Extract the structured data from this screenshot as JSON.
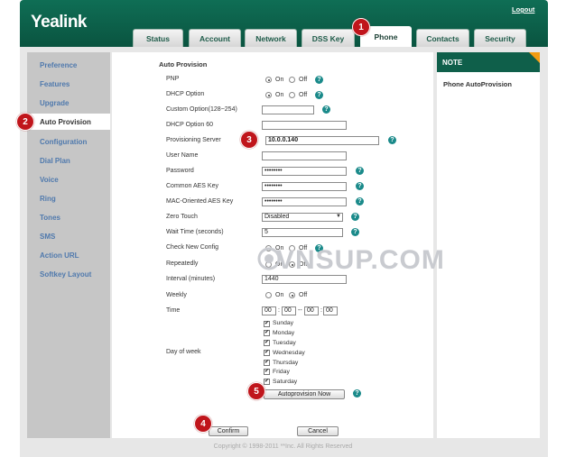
{
  "header": {
    "logo": "Yealink",
    "logout": "Logout"
  },
  "tabs": [
    {
      "label": "Status",
      "active": false
    },
    {
      "label": "Account",
      "active": false
    },
    {
      "label": "Network",
      "active": false
    },
    {
      "label": "DSS Key",
      "active": false
    },
    {
      "label": "Phone",
      "active": true
    },
    {
      "label": "Contacts",
      "active": false
    },
    {
      "label": "Security",
      "active": false
    }
  ],
  "sidebar": {
    "items": [
      "Preference",
      "Features",
      "Upgrade",
      "Auto Provision",
      "Configuration",
      "Dial Plan",
      "Voice",
      "Ring",
      "Tones",
      "SMS",
      "Action URL",
      "Softkey Layout"
    ],
    "active": "Auto Provision"
  },
  "form": {
    "title": "Auto Provision",
    "on": "On",
    "off": "Off",
    "pnp": {
      "label": "PNP",
      "value": "On"
    },
    "dhcp": {
      "label": "DHCP Option",
      "value": "On"
    },
    "custom": {
      "label": "Custom Option(128~254)",
      "value": ""
    },
    "dhcp60": {
      "label": "DHCP Option 60",
      "value": ""
    },
    "server": {
      "label": "Provisioning Server",
      "value": "10.0.0.140"
    },
    "user": {
      "label": "User Name",
      "value": ""
    },
    "password": {
      "label": "Password",
      "value": "••••••••"
    },
    "aes": {
      "label": "Common AES Key",
      "value": "••••••••"
    },
    "mac_aes": {
      "label": "MAC-Oriented AES Key",
      "value": "••••••••"
    },
    "zero": {
      "label": "Zero Touch",
      "value": "Disabled"
    },
    "wait": {
      "label": "Wait Time (seconds)",
      "value": "5"
    },
    "check": {
      "label": "Check New Config",
      "value": "On"
    },
    "repeat": {
      "label": "Repeatedly",
      "value": "Off"
    },
    "interval": {
      "label": "Interval (minutes)",
      "value": "1440"
    },
    "weekly": {
      "label": "Weekly",
      "value": "Off"
    },
    "time": {
      "label": "Time",
      "h1": "00",
      "m1": "00",
      "h2": "00",
      "m2": "00",
      "colon": ":",
      "dash": "--"
    },
    "dow": {
      "label": "Day of week",
      "days": [
        "Sunday",
        "Monday",
        "Tuesday",
        "Wednesday",
        "Thursday",
        "Friday",
        "Saturday"
      ]
    },
    "autoprov_btn": "Autoprovision Now",
    "confirm_btn": "Confirm",
    "cancel_btn": "Cancel",
    "help": "?"
  },
  "note": {
    "title": "NOTE",
    "body": "Phone AutoProvision"
  },
  "footer": "Copyright © 1998-2011 **Inc. All Rights Reserved",
  "watermark": "VNSUP.COM",
  "callouts": [
    "1",
    "2",
    "3",
    "4",
    "5"
  ],
  "colors": {
    "header": "#0f6e55",
    "accent_link": "#4f79ad",
    "callout": "#c0151b",
    "help": "#1a8a8a",
    "note_corner": "#f39c12"
  }
}
